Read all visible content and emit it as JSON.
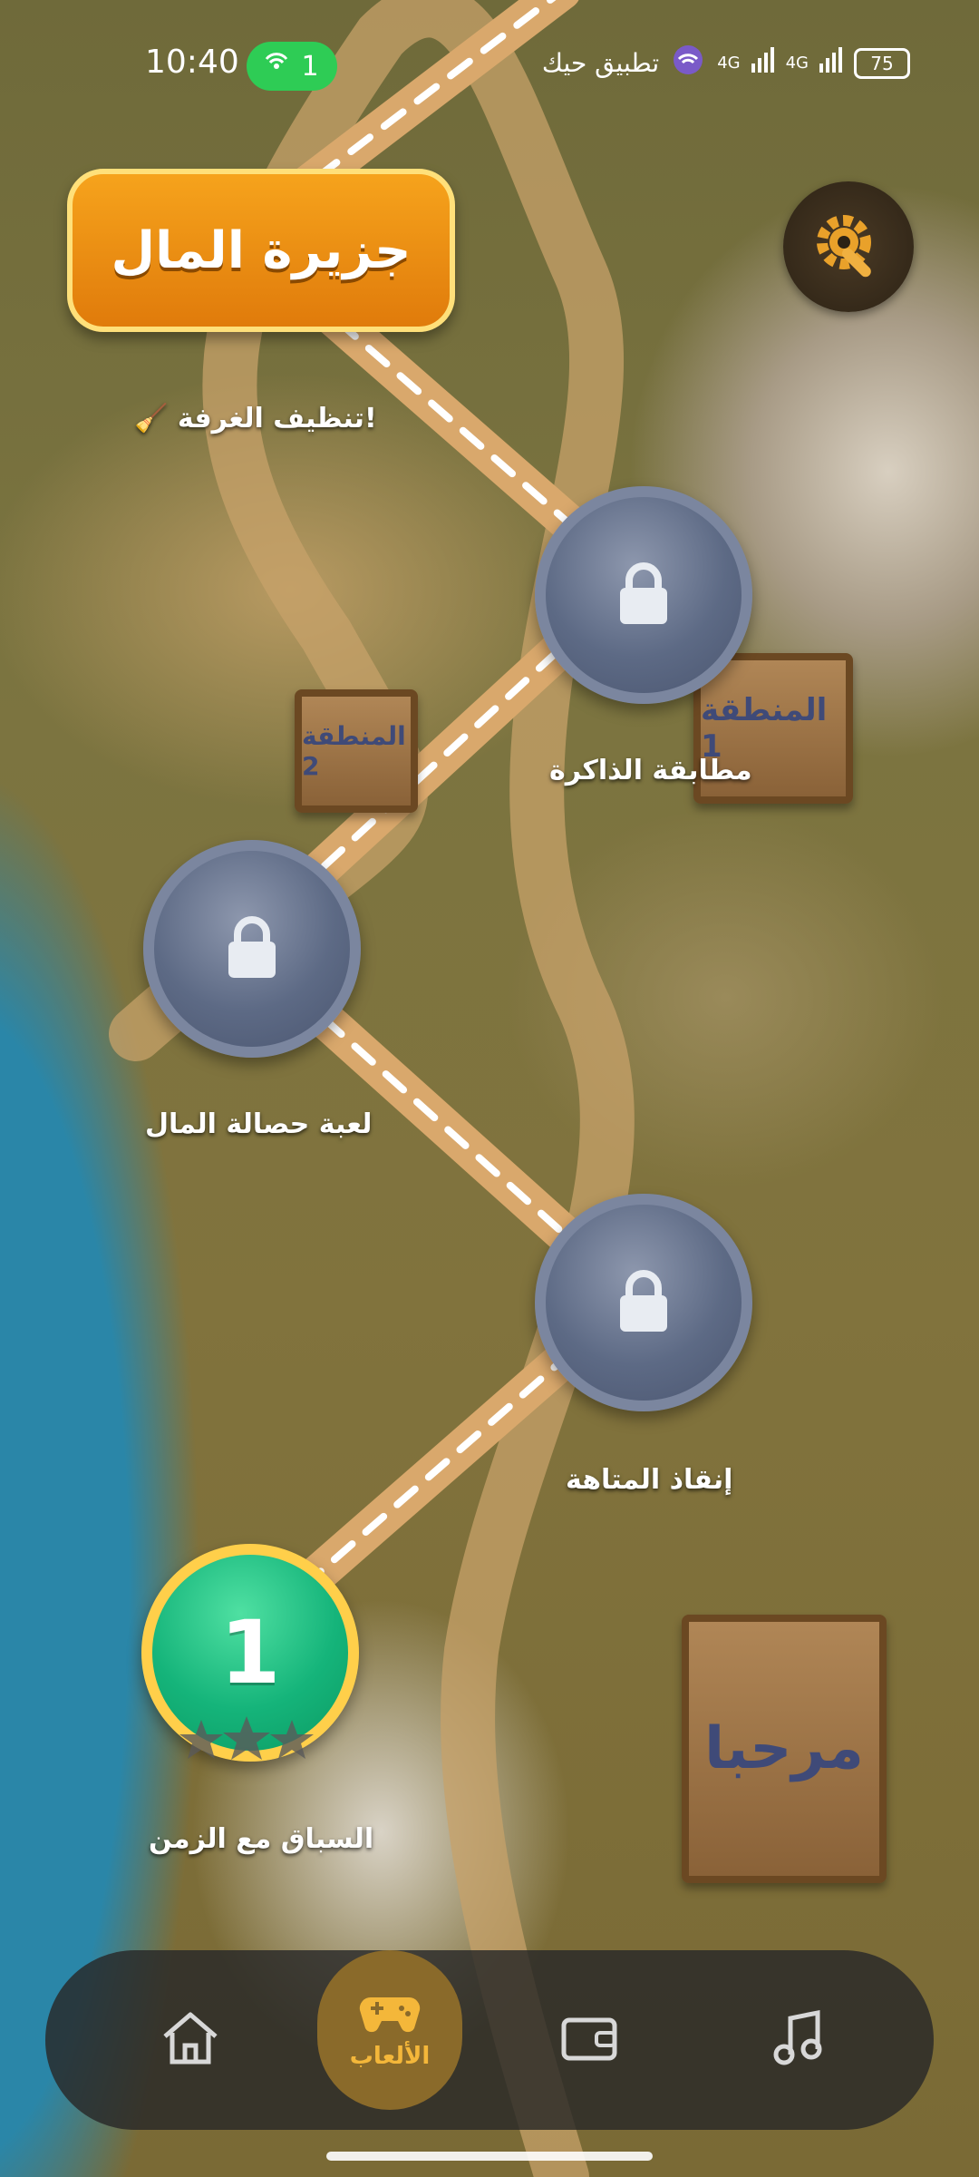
{
  "status_bar": {
    "time": "10:40",
    "hotspot_count": "1",
    "carrier": "تطبيق حيك",
    "network1": "4G",
    "network2": "4G",
    "battery": "75"
  },
  "header": {
    "title": "جزيرة المال"
  },
  "map": {
    "signs": [
      "المنطقة 1",
      "المنطقة 2",
      "مرحبا"
    ],
    "top_note": "🧹 تنظيف الغرفة!"
  },
  "levels": [
    {
      "label": "السباق مع الزمن",
      "number": "1",
      "state": "active"
    },
    {
      "label": "إنقاذ المتاهة",
      "state": "locked"
    },
    {
      "label": "لعبة حصالة المال",
      "state": "locked"
    },
    {
      "label": "مطابقة الذاكرة",
      "state": "locked"
    }
  ],
  "nav": {
    "games_label": "الألعاب"
  },
  "colors": {
    "title_orange": "#f39a16",
    "level_green": "#15b47a",
    "locked_blue": "#5d6a85",
    "nav_gold": "#f4b73a"
  }
}
